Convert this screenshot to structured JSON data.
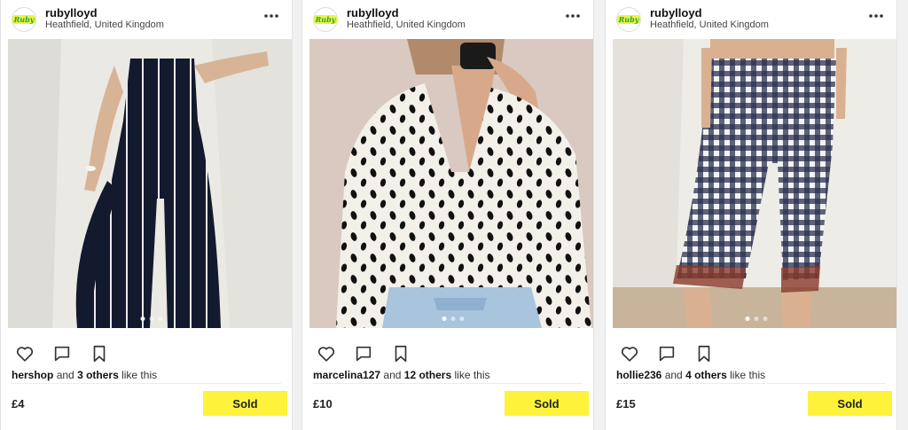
{
  "colors": {
    "accent_yellow": "#fff23a",
    "page_bg": "#f1f1f1",
    "card_bg": "#ffffff"
  },
  "posts": [
    {
      "username": "rubylloyd",
      "location": "Heathfield, United Kingdom",
      "avatar_text": "Ruby",
      "liked_by": "hershop",
      "and_text": "and",
      "others": "3 others",
      "like_suffix": "like this",
      "price": "£4",
      "button_label": "Sold",
      "image": "striped-jumpsuit-photo"
    },
    {
      "username": "rubylloyd",
      "location": "Heathfield, United Kingdom",
      "avatar_text": "Ruby",
      "liked_by": "marcelina127",
      "and_text": "and",
      "others": "12 others",
      "like_suffix": "like this",
      "price": "£10",
      "button_label": "Sold",
      "image": "dalmatian-print-shirt-photo"
    },
    {
      "username": "rubylloyd",
      "location": "Heathfield, United Kingdom",
      "avatar_text": "Ruby",
      "liked_by": "hollie236",
      "and_text": "and",
      "others": "4 others",
      "like_suffix": "like this",
      "price": "£15",
      "button_label": "Sold",
      "image": "gingham-trousers-photo"
    }
  ]
}
